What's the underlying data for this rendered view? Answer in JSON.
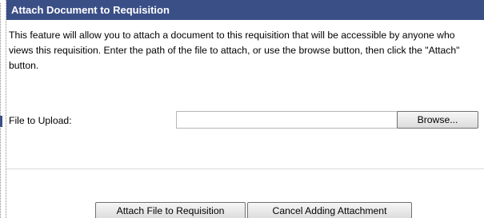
{
  "dialog": {
    "title": "Attach Document to Requisition",
    "description": "This feature will allow you to attach a document to this requisition that will be accessible by anyone who views this requisition.  Enter the path of the file to attach, or use the browse button, then click the \"Attach\" button.",
    "file_label": "File to Upload:",
    "file_value": "",
    "browse_label": "Browse...",
    "attach_label": "Attach File to Requisition",
    "cancel_label": "Cancel Adding Attachment"
  },
  "colors": {
    "title_bar": "#3b4f87",
    "title_text": "#ffffff"
  }
}
